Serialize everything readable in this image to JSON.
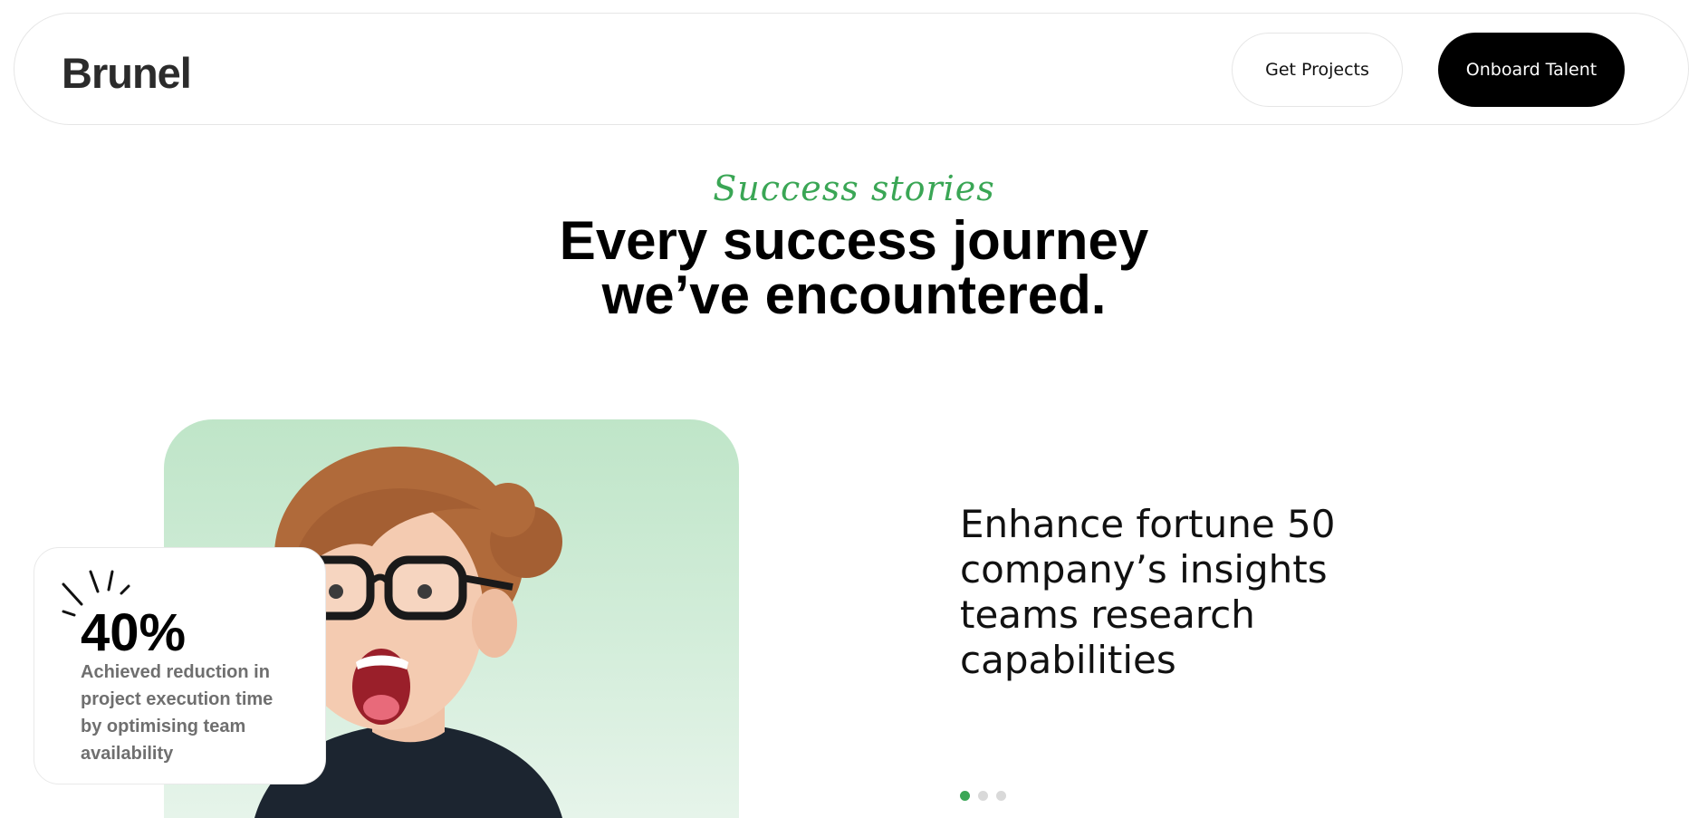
{
  "header": {
    "logo": "Brunel",
    "get_projects_label": "Get Projects",
    "onboard_talent_label": "Onboard Talent"
  },
  "hero": {
    "eyebrow": "Success stories",
    "headline_line1": "Every success journey",
    "headline_line2": "we’ve encountered."
  },
  "stat": {
    "value": "40%",
    "description": "Achieved reduction in project execution time by optimising team availability"
  },
  "story": {
    "title": "Enhance fortune 50 company’s insights teams research capabilities"
  },
  "carousel": {
    "total": 3,
    "active_index": 0
  },
  "colors": {
    "accent_green": "#3aa655",
    "photo_background": "#c6e8cf",
    "button_dark": "#000000"
  }
}
